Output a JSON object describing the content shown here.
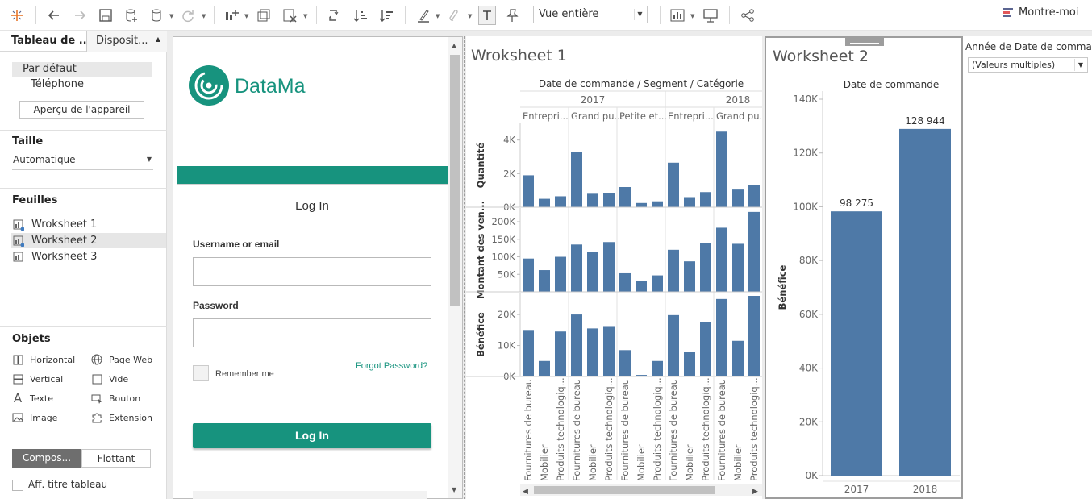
{
  "toolbar": {
    "view_select": "Vue entière",
    "show_me": "Montre-moi",
    "icons": [
      "tableau-logo-icon",
      "undo-icon",
      "redo-icon",
      "save-icon",
      "new-datasource-icon",
      "datasource-icon",
      "refresh-icon",
      "new-worksheet-icon",
      "duplicate-sheet-icon",
      "clear-sheet-icon",
      "swap-icon",
      "sort-ascending-icon",
      "sort-descending-icon",
      "highlight-icon",
      "group-icon",
      "show-labels-icon",
      "pin-icon",
      "show-cards-icon",
      "presentation-icon",
      "share-icon"
    ]
  },
  "left_panel": {
    "tab_dashboard": "Tableau de ...",
    "tab_layout": "Disposit...",
    "device_default": "Par défaut",
    "device_phone": "Téléphone",
    "device_preview_button": "Aperçu de l'appareil",
    "size_title": "Taille",
    "size_value": "Automatique",
    "sheets_title": "Feuilles",
    "sheets": [
      {
        "label": "Wroksheet 1"
      },
      {
        "label": "Worksheet 2"
      },
      {
        "label": "Worksheet 3"
      }
    ],
    "objects_title": "Objets",
    "objects": {
      "horizontal": "Horizontal",
      "web_page": "Page Web",
      "vertical": "Vertical",
      "blank": "Vide",
      "text": "Texte",
      "button": "Bouton",
      "image": "Image",
      "extension": "Extension"
    },
    "tiled_button": "Compos...",
    "floating_button": "Flottant",
    "show_title_checkbox": "Aff. titre tableau"
  },
  "web_page": {
    "logo_text": "DataMa",
    "login_title": "Log In",
    "username_label": "Username or email",
    "password_label": "Password",
    "remember_me": "Remember me",
    "forgot_password": "Forgot Password?",
    "login_button": "Log In",
    "accent_color": "#17937e"
  },
  "worksheet1": {
    "title": "Wroksheet 1",
    "column_header": "Date de commande / Segment / Catégorie",
    "years": [
      "2017",
      "2018"
    ],
    "segments": [
      "Entrepri...",
      "Grand pu...",
      "Petite et...",
      "Entrepri...",
      "Grand pu..."
    ],
    "row_labels": [
      "Quantité",
      "Montant des ven...",
      "Bénéfice"
    ],
    "quantite_ticks": [
      "4K",
      "2K",
      "0K"
    ],
    "montant_ticks": [
      "200K",
      "150K",
      "100K",
      "50K"
    ],
    "benefice_ticks": [
      "20K",
      "10K",
      "0K"
    ],
    "categories": [
      "Fournitures de bureau",
      "Mobilier",
      "Produits technologiq...",
      "Fournitures de bureau",
      "Mobilier",
      "Produits technologiq...",
      "Fournitures de bureau",
      "Mobilier",
      "Produits technologiq...",
      "Fournitures de bureau",
      "Mobilier",
      "Produits technologiq...",
      "Fournitures de bureau",
      "Mobilier",
      "Produits technologiq..."
    ],
    "bar_color": "#4e79a7"
  },
  "worksheet2": {
    "title": "Worksheet 2",
    "column_header": "Date de commande",
    "y_axis_label": "Bénéfice",
    "y_ticks": [
      "140K",
      "120K",
      "100K",
      "80K",
      "60K",
      "40K",
      "20K",
      "0K"
    ],
    "value_labels": [
      "98 275",
      "128 944"
    ],
    "categories": [
      "2017",
      "2018"
    ]
  },
  "filter": {
    "title": "Année de Date de comma...",
    "value": "(Valeurs multiples)"
  },
  "chart_data": [
    {
      "type": "bar",
      "title": "Wroksheet 1",
      "categories": [
        "2017 Entrepri... Fournitures de bureau",
        "2017 Entrepri... Mobilier",
        "2017 Entrepri... Produits technologiq...",
        "2017 Grand pu... Fournitures de bureau",
        "2017 Grand pu... Mobilier",
        "2017 Grand pu... Produits technologiq...",
        "2017 Petite et... Fournitures de bureau",
        "2017 Petite et... Mobilier",
        "2017 Petite et... Produits technologiq...",
        "2018 Entrepri... Fournitures de bureau",
        "2018 Entrepri... Mobilier",
        "2018 Entrepri... Produits technologiq...",
        "2018 Grand pu... Fournitures de bureau",
        "2018 Grand pu... Mobilier",
        "2018 Grand pu... Produits technologiq..."
      ],
      "series": [
        {
          "name": "Quantité",
          "values": [
            1900,
            500,
            650,
            3300,
            800,
            850,
            1200,
            250,
            350,
            2650,
            600,
            900,
            4500,
            1050,
            1300
          ],
          "ylim": [
            0,
            4800
          ]
        },
        {
          "name": "Montant des ven...",
          "values": [
            95000,
            62000,
            100000,
            135000,
            115000,
            142000,
            53000,
            32000,
            47000,
            120000,
            87000,
            138000,
            183000,
            137000,
            228000
          ],
          "ylim": [
            0,
            230000
          ]
        },
        {
          "name": "Bénéfice",
          "values": [
            15000,
            5000,
            14500,
            20000,
            15500,
            16000,
            8500,
            500,
            5000,
            19800,
            7800,
            17500,
            25000,
            11500,
            26000
          ],
          "ylim": [
            0,
            26000
          ]
        }
      ]
    },
    {
      "type": "bar",
      "title": "Worksheet 2",
      "categories": [
        "2017",
        "2018"
      ],
      "values": [
        98275,
        128944
      ],
      "xlabel": "Date de commande",
      "ylabel": "Bénéfice",
      "ylim": [
        0,
        140000
      ]
    }
  ]
}
